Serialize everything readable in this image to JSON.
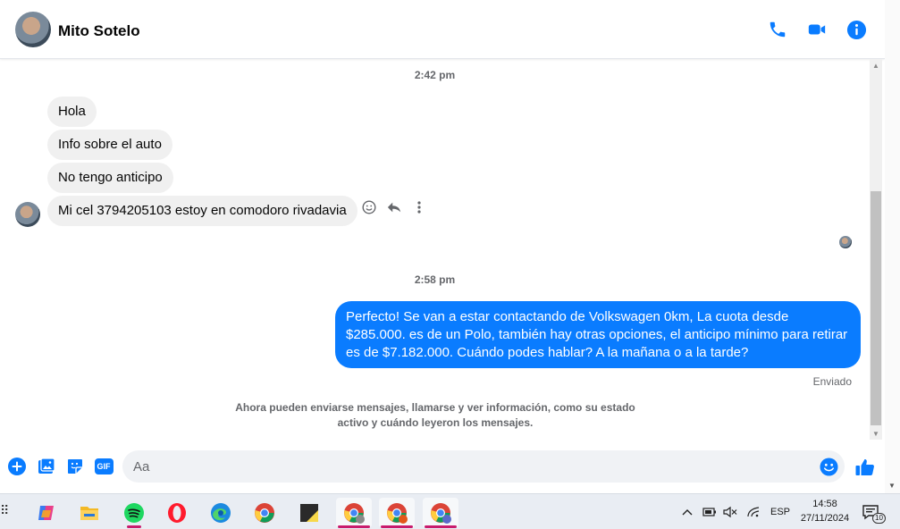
{
  "header": {
    "contact_name": "Mito Sotelo",
    "accent_color": "#0a7cff",
    "icons": [
      "phone-icon",
      "video-camera-icon",
      "info-icon"
    ]
  },
  "conversation": {
    "timestamp_1": "2:42 pm",
    "incoming": [
      "Hola",
      "Info sobre el auto",
      "No tengo anticipo",
      "Mi cel 3794205103 estoy en comodoro rivadavia"
    ],
    "timestamp_2": "2:58 pm",
    "outgoing": "Perfecto!  Se van a estar contactando de Volkswagen 0km, La cuota desde $285.000. es de un Polo, también hay otras opciones, el anticipo mínimo para retirar es de $7.182.000. Cuándo podes hablar? A la mañana o a la tarde?",
    "status": "Enviado",
    "system_note": "Ahora pueden enviarse mensajes, llamarse y ver información, como su estado activo y cuándo leyeron los mensajes."
  },
  "composer": {
    "placeholder": "Aa",
    "gif_label": "GIF"
  },
  "taskbar": {
    "language": "ESP",
    "time": "14:58",
    "date": "27/11/2024",
    "notification_count": "10"
  }
}
